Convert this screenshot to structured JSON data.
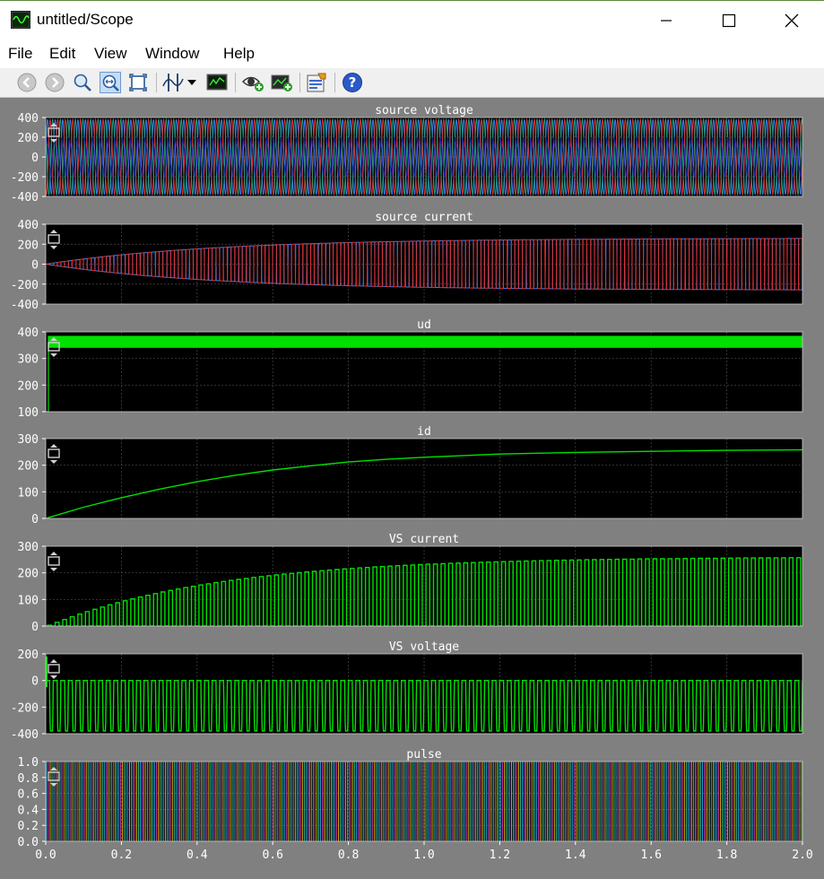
{
  "window": {
    "title": "untitled/Scope",
    "minimize_glyph": "—",
    "maximize_glyph": "☐",
    "close_glyph": "✕"
  },
  "menu": [
    "File",
    "Edit",
    "View",
    "Window",
    "Help"
  ],
  "toolbar": {
    "icons": [
      "back-icon",
      "forward-icon",
      "zoom-icon",
      "zoom-x-icon",
      "zoom-axes-icon",
      "cursor-measurement-icon",
      "dropdown-arrow-icon",
      "signal-statistics-icon",
      "highlight-simulink-block-icon",
      "signal-selector-icon",
      "style-icon",
      "help-icon"
    ],
    "help_glyph": "?"
  },
  "colors": {
    "plot_bg": "#000000",
    "figure_bg": "#808080",
    "axis_text": "#ffffff",
    "grid": "#4a4a4a",
    "green": "#00e000",
    "blue": "#3c7df0",
    "red": "#e03030",
    "dark_blue": "#2020a0",
    "teal": "#20a080"
  },
  "chart_data": [
    {
      "type": "line",
      "title": "source voltage",
      "ylim": [
        -400,
        400
      ],
      "yticks": [
        "400",
        "200",
        "0",
        "-200",
        "-400"
      ],
      "xlim": [
        0,
        2
      ],
      "grid": true,
      "series": [
        {
          "color": "#3c7df0",
          "description": "three-phase sinusoid, amplitude ~380, 50 Hz"
        },
        {
          "color": "#e03030",
          "description": "phase shifted +120 deg"
        },
        {
          "color": "#20a080",
          "description": "phase shifted -120 deg"
        }
      ]
    },
    {
      "type": "line",
      "title": "source current",
      "ylim": [
        -400,
        400
      ],
      "yticks": [
        "400",
        "200",
        "0",
        "-200",
        "-400"
      ],
      "xlim": [
        0,
        2
      ],
      "grid": true,
      "envelope": {
        "start": 0,
        "end": 260,
        "tau": 0.45
      },
      "series": [
        {
          "color": "#3c7df0"
        },
        {
          "color": "#e03030"
        }
      ]
    },
    {
      "type": "line",
      "title": "ud",
      "ylim": [
        100,
        400
      ],
      "yticks": [
        "400",
        "300",
        "200",
        "100"
      ],
      "xlim": [
        0,
        2
      ],
      "grid": true,
      "band": [
        340,
        385
      ],
      "initial": 100,
      "series": [
        {
          "color": "#00e000"
        }
      ]
    },
    {
      "type": "line",
      "title": "id",
      "ylim": [
        0,
        300
      ],
      "yticks": [
        "300",
        "200",
        "100",
        "0"
      ],
      "xlim": [
        0,
        2
      ],
      "grid": true,
      "x": [
        0,
        0.1,
        0.2,
        0.3,
        0.4,
        0.5,
        0.6,
        0.7,
        0.8,
        0.9,
        1.0,
        1.2,
        1.4,
        1.6,
        1.8,
        2.0
      ],
      "y": [
        0,
        42,
        78,
        110,
        138,
        162,
        182,
        198,
        212,
        222,
        230,
        242,
        248,
        252,
        256,
        258
      ],
      "series": [
        {
          "color": "#00e000"
        }
      ]
    },
    {
      "type": "line",
      "title": "VS current",
      "ylim": [
        0,
        300
      ],
      "yticks": [
        "300",
        "200",
        "100",
        "0"
      ],
      "xlim": [
        0,
        2
      ],
      "grid": true,
      "pulses": 100,
      "envelope": {
        "start": 0,
        "end": 260,
        "tau": 0.45
      },
      "series": [
        {
          "color": "#00e000"
        }
      ]
    },
    {
      "type": "line",
      "title": "VS voltage",
      "ylim": [
        -400,
        200
      ],
      "yticks": [
        "200",
        "0",
        "-200",
        "-400"
      ],
      "xlim": [
        0,
        2
      ],
      "grid": true,
      "range": [
        -380,
        0
      ],
      "series": [
        {
          "color": "#00e000"
        }
      ]
    },
    {
      "type": "line",
      "title": "pulse",
      "ylim": [
        0,
        1
      ],
      "yticks": [
        "1.0",
        "0.8",
        "0.6",
        "0.4",
        "0.2",
        "0.0"
      ],
      "xlim": [
        0,
        2
      ],
      "xticks": [
        "0.0",
        "0.2",
        "0.4",
        "0.6",
        "0.8",
        "1.0",
        "1.2",
        "1.4",
        "1.6",
        "1.8",
        "2.0"
      ],
      "grid": true,
      "series": [
        {
          "color": "#3cb4f0"
        },
        {
          "color": "#e050c0"
        },
        {
          "color": "#f0c020"
        },
        {
          "color": "#40d0a0"
        }
      ]
    }
  ]
}
